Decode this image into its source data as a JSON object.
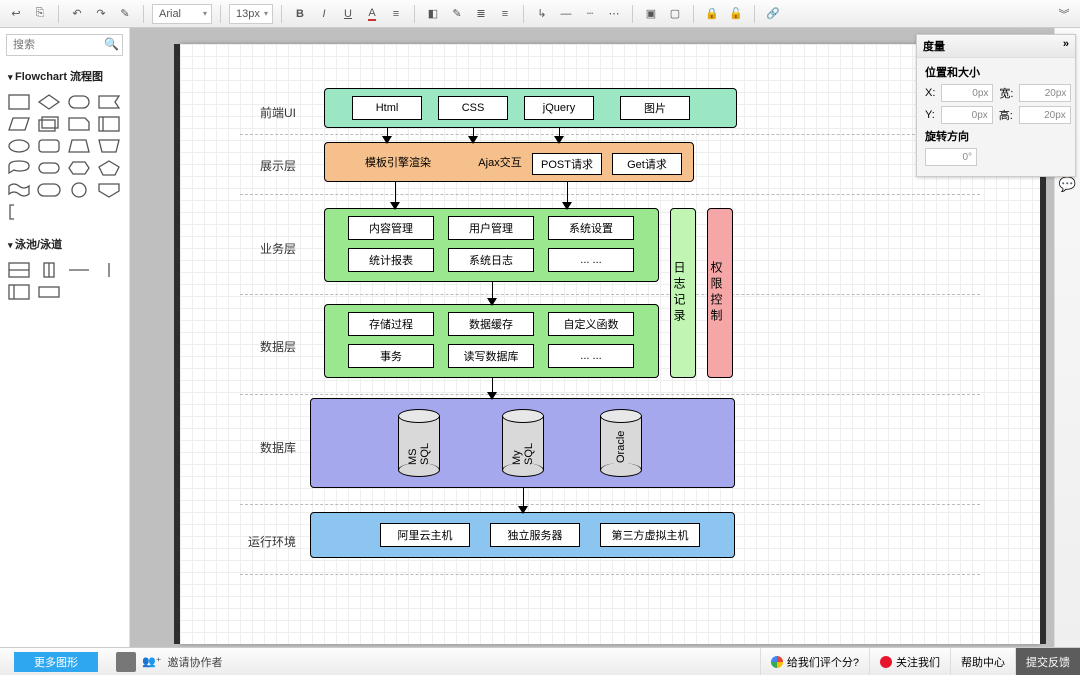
{
  "toolbar": {
    "font": "Arial",
    "size": "13px"
  },
  "search": {
    "placeholder": "搜索"
  },
  "sections": {
    "flowchart": "Flowchart 流程图",
    "pool": "泳池/泳道"
  },
  "more_shapes": "更多图形",
  "collab": {
    "invite": "邀请协作者"
  },
  "bottom": {
    "rate": "给我们评个分?",
    "follow": "关注我们",
    "help": "帮助中心",
    "feedback": "提交反馈"
  },
  "inspector": {
    "title": "度量",
    "pos_title": "位置和大小",
    "x": "X:",
    "y": "Y:",
    "w": "宽:",
    "h": "高:",
    "xval": "0px",
    "yval": "0px",
    "wval": "20px",
    "hval": "20px",
    "rot_title": "旋转方向",
    "rotval": "0°"
  },
  "labels": {
    "frontend": "前端UI",
    "present": "展示层",
    "biz": "业务层",
    "data": "数据层",
    "db": "数据库",
    "runtime": "运行环境"
  },
  "boxes": {
    "html": "Html",
    "css": "CSS",
    "jquery": "jQuery",
    "img": "图片",
    "tpl": "模板引擎渲染",
    "ajax": "Ajax交互",
    "post": "POST请求",
    "get": "Get请求",
    "content": "内容管理",
    "user": "用户管理",
    "sys": "系统设置",
    "stats": "统计报表",
    "syslog": "系统日志",
    "dots1": "... ...",
    "sp": "存储过程",
    "cache": "数据缓存",
    "fn": "自定义函数",
    "tx": "事务",
    "rw": "读写数据库",
    "dots2": "... ...",
    "mssql": "MS SQL",
    "mysql": "My SQL",
    "oracle": "Oracle",
    "aliyun": "阿里云主机",
    "dedi": "独立服务器",
    "vhost": "第三方虚拟主机",
    "log": "日志记录",
    "auth": "权限控制"
  }
}
